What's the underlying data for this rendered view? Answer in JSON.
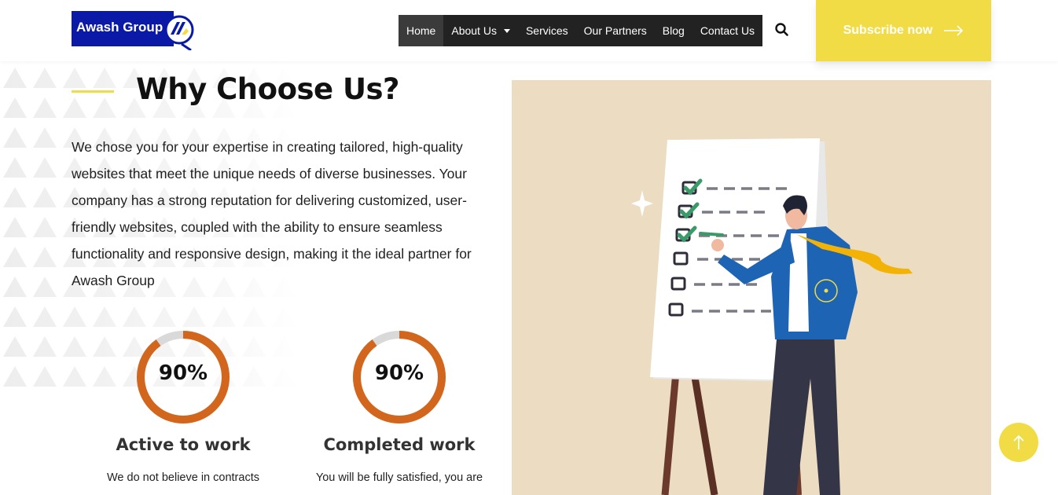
{
  "brand": {
    "name": "Awash Group"
  },
  "nav": {
    "items": [
      {
        "label": "Home",
        "active": true
      },
      {
        "label": "About Us",
        "dropdown": true
      },
      {
        "label": "Services"
      },
      {
        "label": "Our Partners"
      },
      {
        "label": "Blog"
      },
      {
        "label": "Contact Us"
      }
    ]
  },
  "header": {
    "subscribe_label": "Subscribe now"
  },
  "section": {
    "title": "Why Choose Us?",
    "intro": "We chose you for your expertise in creating tailored, high-quality websites that meet the unique needs of diverse businesses. Your company has a strong reputation for delivering customized, user-friendly websites, coupled with the ability to ensure seamless functionality and responsive design, making it the ideal partner for Awash Group"
  },
  "stats": [
    {
      "value": "90%",
      "percent": 90,
      "title": "Active to work",
      "desc": "We do not believe in contracts"
    },
    {
      "value": "90%",
      "percent": 90,
      "title": "Completed work",
      "desc": "You will be fully satisfied, you are"
    }
  ],
  "colors": {
    "accent_yellow": "#f2dc45",
    "ring_orange": "#d2661d",
    "ring_track": "#d9d9d9",
    "nav_bg": "#222222",
    "logo_blue": "#0a1aa6",
    "illustration_bg": "#ecdcc1"
  },
  "icons": {
    "search": "search-icon",
    "subscribe_arrow": "arrow-right-icon",
    "scroll_top": "arrow-up-icon"
  }
}
